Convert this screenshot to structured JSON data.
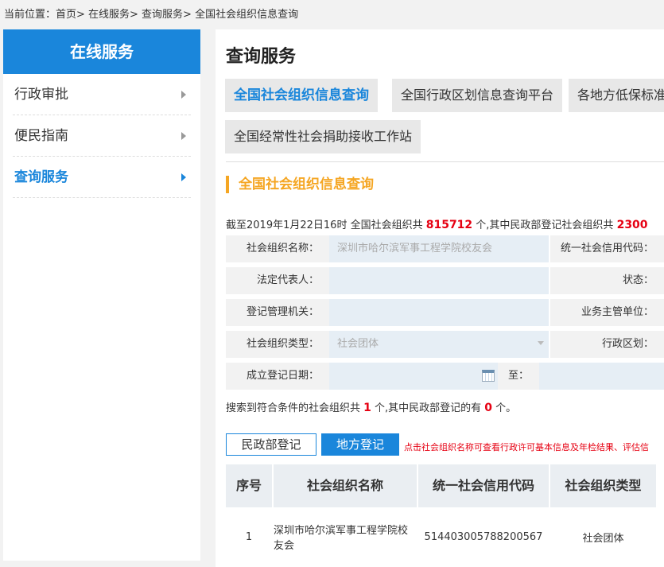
{
  "breadcrumb": "当前位置：首页> 在线服务> 查询服务> 全国社会组织信息查询",
  "sidebar": {
    "title": "在线服务",
    "items": [
      {
        "label": "行政审批",
        "active": false
      },
      {
        "label": "便民指南",
        "active": false
      },
      {
        "label": "查询服务",
        "active": true
      }
    ]
  },
  "main": {
    "title": "查询服务",
    "tabs": [
      {
        "label": "全国社会组织信息查询",
        "active": true
      },
      {
        "label": "全国行政区划信息查询平台",
        "active": false
      },
      {
        "label": "各地方低保标准",
        "active": false
      },
      {
        "label": "全国经常性社会捐助接收工作站",
        "active": false
      }
    ],
    "section_title": "全国社会组织信息查询",
    "stats": {
      "prefix": "截至2019年1月22日16时 全国社会组织共 ",
      "total": "815712",
      "middle": " 个,其中民政部登记社会组织共 ",
      "ministry": "2300"
    },
    "form": {
      "org_name_label": "社会组织名称：",
      "org_name_value": "深圳市哈尔滨军事工程学院校友会",
      "credit_code_label": "统一社会信用代码：",
      "legal_rep_label": "法定代表人：",
      "status_label": "状态：",
      "reg_authority_label": "登记管理机关：",
      "supervisor_label": "业务主管单位：",
      "org_type_label": "社会组织类型：",
      "org_type_value": "社会团体",
      "region_label": "行政区划：",
      "reg_date_label": "成立登记日期：",
      "to_label": "至："
    },
    "result": {
      "prefix": "搜索到符合条件的社会组织共 ",
      "count": "1",
      "middle": " 个,其中民政部登记的有 ",
      "ministry_count": "0",
      "suffix": " 个。"
    },
    "buttons": {
      "ministry": "民政部登记",
      "local": "地方登记"
    },
    "hint": "点击社会组织名称可查看行政许可基本信息及年检结果、评估信",
    "table": {
      "headers": [
        "序号",
        "社会组织名称",
        "统一社会信用代码",
        "社会组织类型"
      ],
      "rows": [
        {
          "index": "1",
          "name": "深圳市哈尔滨军事工程学院校友会",
          "code": "514403005788200567",
          "type": "社会团体"
        }
      ]
    }
  }
}
